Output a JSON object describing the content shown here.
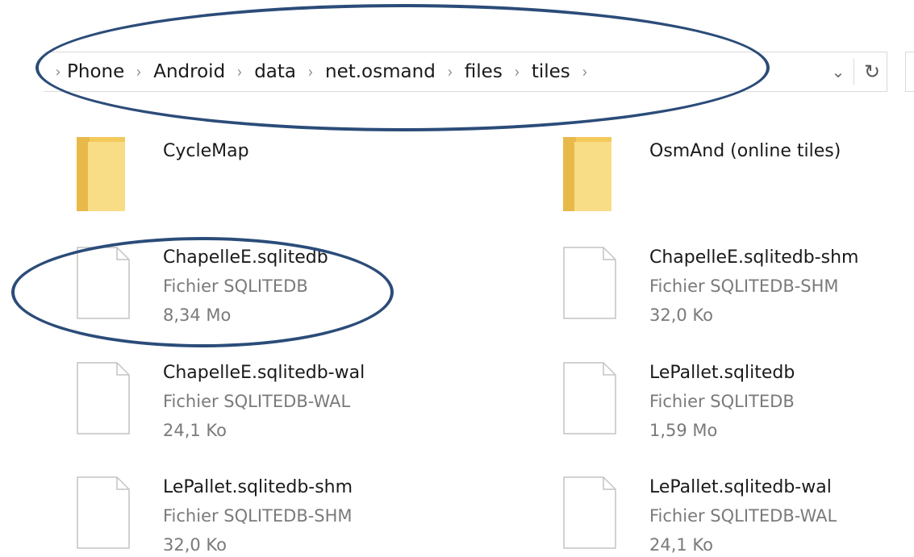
{
  "address_bar": {
    "lead_chevron": "›",
    "separator": "›",
    "crumbs": [
      "Phone",
      "Android",
      "data",
      "net.osmand",
      "files",
      "tiles"
    ],
    "trailing_separator": "›",
    "dropdown_glyph": "⌄",
    "refresh_glyph": "↻"
  },
  "items": [
    {
      "kind": "folder",
      "name": "CycleMap",
      "type": "",
      "size": ""
    },
    {
      "kind": "folder",
      "name": "OsmAnd (online tiles)",
      "type": "",
      "size": ""
    },
    {
      "kind": "file",
      "name": "ChapelleE.sqlitedb",
      "type": "Fichier SQLITEDB",
      "size": "8,34 Mo"
    },
    {
      "kind": "file",
      "name": "ChapelleE.sqlitedb-shm",
      "type": "Fichier SQLITEDB-SHM",
      "size": "32,0 Ko"
    },
    {
      "kind": "file",
      "name": "ChapelleE.sqlitedb-wal",
      "type": "Fichier SQLITEDB-WAL",
      "size": "24,1 Ko"
    },
    {
      "kind": "file",
      "name": "LePallet.sqlitedb",
      "type": "Fichier SQLITEDB",
      "size": "1,59 Mo"
    },
    {
      "kind": "file",
      "name": "LePallet.sqlitedb-shm",
      "type": "Fichier SQLITEDB-SHM",
      "size": "32,0 Ko"
    },
    {
      "kind": "file",
      "name": "LePallet.sqlitedb-wal",
      "type": "Fichier SQLITEDB-WAL",
      "size": "24,1 Ko"
    }
  ],
  "colors": {
    "annotation": "#2b4c79",
    "folder": "#f5d67a",
    "folder_dark": "#e9bd4c",
    "file_border": "#c8c8c8"
  }
}
